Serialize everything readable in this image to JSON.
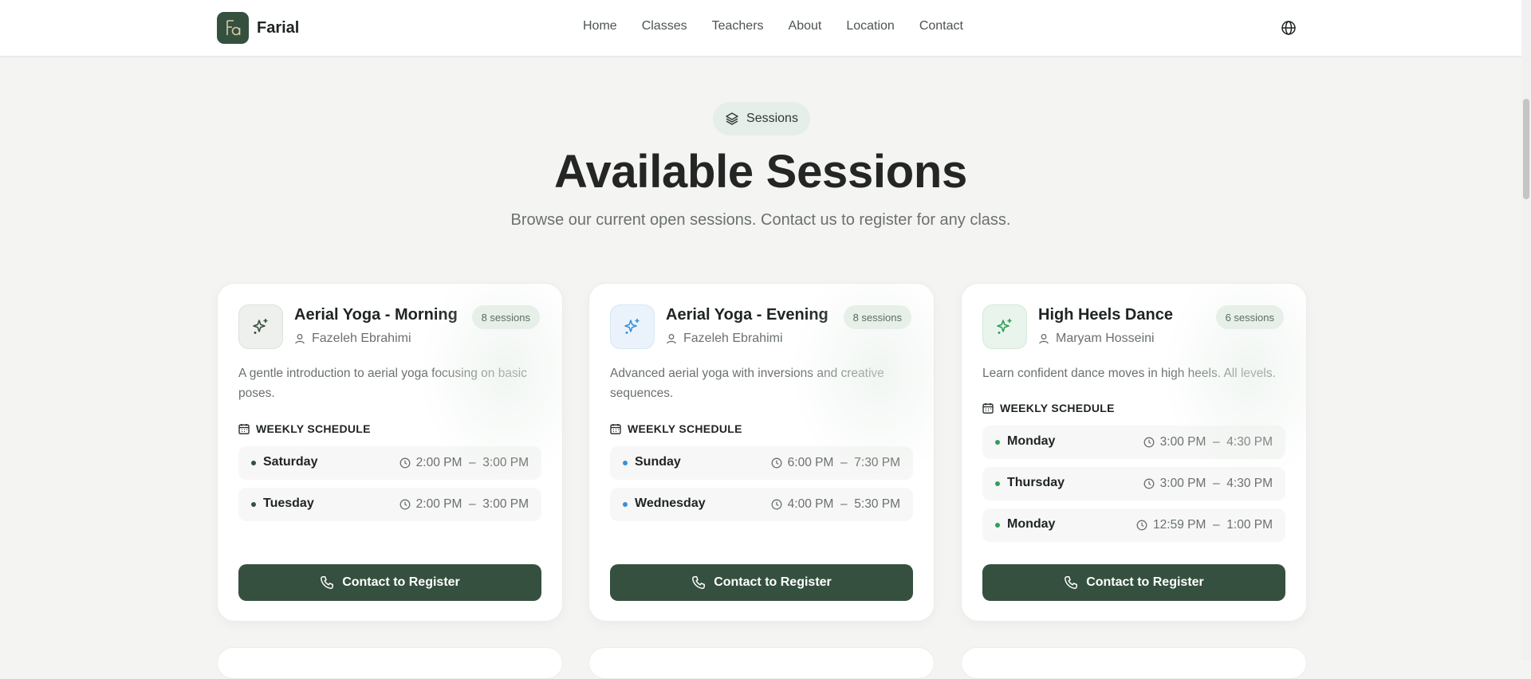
{
  "brand": {
    "name": "Farial"
  },
  "nav": [
    "Home",
    "Classes",
    "Teachers",
    "About",
    "Location",
    "Contact"
  ],
  "language_icon": "globe-icon",
  "hero": {
    "pill_label": "Sessions",
    "pill_icon": "layers-icon",
    "title": "Available Sessions",
    "subtitle": "Browse our current open sessions. Contact us to register for any class."
  },
  "schedule_heading": "WEEKLY SCHEDULE",
  "cta_label": "Contact to Register",
  "colors": {
    "primary": "#35503f",
    "card1_accent": "#35503f",
    "card2_accent": "#3b8fd6",
    "card3_accent": "#2f9e5b"
  },
  "cards": [
    {
      "title": "Aerial Yoga - Morning",
      "badge": "8 sessions",
      "teacher": "Fazeleh Ebrahimi",
      "description": "A gentle introduction to aerial yoga focusing on basic poses.",
      "schedule": [
        {
          "day": "Saturday",
          "start": "2:00 PM",
          "sep": "–",
          "end": "3:00 PM"
        },
        {
          "day": "Tuesday",
          "start": "2:00 PM",
          "sep": "–",
          "end": "3:00 PM"
        }
      ]
    },
    {
      "title": "Aerial Yoga - Evening",
      "badge": "8 sessions",
      "teacher": "Fazeleh Ebrahimi",
      "description": "Advanced aerial yoga with inversions and creative sequences.",
      "schedule": [
        {
          "day": "Sunday",
          "start": "6:00 PM",
          "sep": "–",
          "end": "7:30 PM"
        },
        {
          "day": "Wednesday",
          "start": "4:00 PM",
          "sep": "–",
          "end": "5:30 PM"
        }
      ]
    },
    {
      "title": "High Heels Dance",
      "badge": "6 sessions",
      "teacher": "Maryam Hosseini",
      "description": "Learn confident dance moves in high heels. All levels.",
      "schedule": [
        {
          "day": "Monday",
          "start": "3:00 PM",
          "sep": "–",
          "end": "4:30 PM"
        },
        {
          "day": "Thursday",
          "start": "3:00 PM",
          "sep": "–",
          "end": "4:30 PM"
        },
        {
          "day": "Monday",
          "start": "12:59 PM",
          "sep": "–",
          "end": "1:00 PM"
        }
      ]
    }
  ]
}
